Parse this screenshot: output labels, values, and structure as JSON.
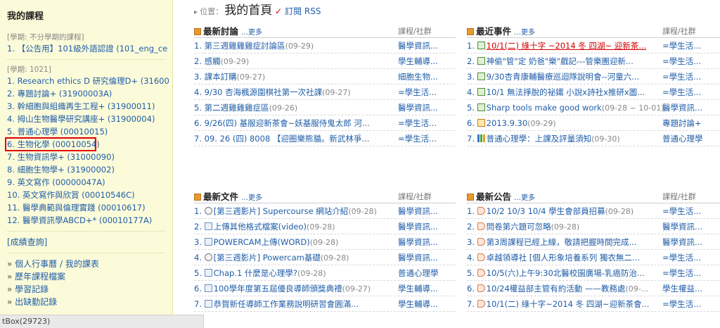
{
  "sidebar": {
    "title": "我的課程",
    "term_all": "[學期: 不分學期的課程]",
    "term_all_courses": [
      "1. 【公告用】101級外語認證 (101_eng_ce"
    ],
    "term_1021": "[學期: 1021]",
    "courses": [
      "1. Research ethics D 研究倫理D+ (31600",
      "2. 專題討論+ (31900003A)",
      "3. 幹細胞與組織再生工程+ (31900011)",
      "4. 拇山生物醫學研究講座+ (31900004)",
      "5. 普通心理學 (00010015)",
      "6. 生物化學 (00010054)",
      "7. 生物資訊學+ (31000090)",
      "8. 細胞生物學+ (31900002)",
      "9. 英文寫作 (00000047A)",
      "10. 英文寫作與欣賞 (00010546C)",
      "11. 醫學典範與倫理實踐 (00010617)",
      "12. 醫學資訊學ABCD+* (00010177A)"
    ],
    "grades_link": "[成績查詢]",
    "links": [
      "個人行事曆 / 我的課表",
      "歷年課程檔案",
      "學習記錄",
      "出缺勤記錄"
    ]
  },
  "status_bar": "tBox(29723)",
  "breadcrumb": {
    "location_label": "位置",
    "page_title": "我的首頁",
    "rss_label": "訂閱 RSS"
  },
  "panels": {
    "discussions": {
      "title": "最新討論",
      "more": "更多",
      "col": "課程/社群",
      "rows": [
        {
          "text": "1. 第三週雞雞雞症討論區",
          "date": "(09-29)",
          "cat": "醫學資訊..."
        },
        {
          "text": "2. 感觸",
          "date": "(09-29)",
          "cat": "學生輔導..."
        },
        {
          "text": "3. 課本訂購",
          "date": "(09-27)",
          "cat": "細胞生物..."
        },
        {
          "text": "4. 9/30 杏海楓源圍棋社第一次社課",
          "date": "(09-27)",
          "cat": "=學生活..."
        },
        {
          "text": "5. 第二週雞雞雞症區",
          "date": "(09-26)",
          "cat": "醫學資訊..."
        },
        {
          "text": "6. 9/26(四) 基服迎新茶會~妖基服侍鬼太郎 河...",
          "date": "",
          "cat": "=學生活..."
        },
        {
          "text": "7. 09. 26 (四) 8008 【迎圈樂熊貓。新武林爭...",
          "date": "",
          "cat": "=學生活..."
        }
      ]
    },
    "events": {
      "title": "最近事件",
      "more": "更多",
      "col": "課程/社群",
      "rows": [
        {
          "text": "10/1(二) 綠十字 ~2014 冬 四湖~ 迎新茶...",
          "date": "",
          "cat": "=學生活...",
          "icon": "cal",
          "red": true
        },
        {
          "text": "神偷\"管\"定 奶爸\"樂\"戲記---管樂團迎新...",
          "date": "",
          "cat": "=學生活...",
          "icon": "cal"
        },
        {
          "text": "9/30杏青康輔醫療巡迴隊說明會--河童六...",
          "date": "",
          "cat": "=學生活...",
          "icon": "cal"
        },
        {
          "text": "10/1 無法掙脫的祕鐵 小說x詩社x推研x圖...",
          "date": "",
          "cat": "=學生活...",
          "icon": "cal"
        },
        {
          "text": "Sharp tools make good work",
          "date": "(09-28 ~ 10-01)",
          "cat": "醫學資訊...",
          "icon": "cal"
        },
        {
          "text": "2013.9.30",
          "date": "(09-29)",
          "cat": "專題討論+",
          "icon": "pen"
        },
        {
          "text": "普通心理學：上課及評量須知",
          "date": "(09-30)",
          "cat": "普通心理學",
          "icon": "bar"
        }
      ]
    },
    "documents": {
      "title": "最新文件",
      "more": "更多",
      "col": "課程/社群",
      "rows": [
        {
          "text": "[第三週影片] Supercourse 網站介紹",
          "date": "(09-28)",
          "cat": "醫學資訊...",
          "icon": "vid"
        },
        {
          "text": "上傳其他格式檔案(video)",
          "date": "(09-28)",
          "cat": "醫學資訊...",
          "icon": "doc"
        },
        {
          "text": "POWERCAM上傳(WORD)",
          "date": "(09-28)",
          "cat": "醫學資訊...",
          "icon": "doc"
        },
        {
          "text": "[第三週影片] Powercam基礎",
          "date": "(09-28)",
          "cat": "醫學資訊...",
          "icon": "vid"
        },
        {
          "text": "Chap.1 什麼是心理學?",
          "date": "(09-28)",
          "cat": "普通心理學",
          "icon": "doc"
        },
        {
          "text": "100學年度第五屆優良導師頒獎典禮",
          "date": "(09-27)",
          "cat": "學生輔導...",
          "icon": "doc"
        },
        {
          "text": "恭賀新任導師工作業務說明研習會圓滿...",
          "date": "",
          "cat": "學生輔導...",
          "icon": "doc"
        }
      ]
    },
    "announcements": {
      "title": "最新公告",
      "more": "更多",
      "col": "課程/社群",
      "rows": [
        {
          "text": "10/2 10/3 10/4 學生會部員招募",
          "date": "(09-28)",
          "cat": "=學生活...",
          "icon": "tag"
        },
        {
          "text": "問卷第六題可忽略",
          "date": "(09-28)",
          "cat": "醫學資訊...",
          "icon": "tag"
        },
        {
          "text": "第3周課程已經上線，敬請把握時間完成...",
          "date": "",
          "cat": "醫學資訊...",
          "icon": "tag"
        },
        {
          "text": "卓越領導社 [個人形象培養系列 獨衣無二...",
          "date": "",
          "cat": "=學生活...",
          "icon": "tag"
        },
        {
          "text": "10/5(六)上午9:30北醫校園廣場-乳癌防治...",
          "date": "",
          "cat": "=學生活...",
          "icon": "tag"
        },
        {
          "text": "10/24權益部主管有約活動 ——教務處",
          "date": "(09-...",
          "cat": "學生權益...",
          "icon": "tag"
        },
        {
          "text": "10/1(二) 綠十字~2014 冬 四湖~迎新茶會...",
          "date": "",
          "cat": "=學生活...",
          "icon": "tag"
        }
      ]
    }
  }
}
